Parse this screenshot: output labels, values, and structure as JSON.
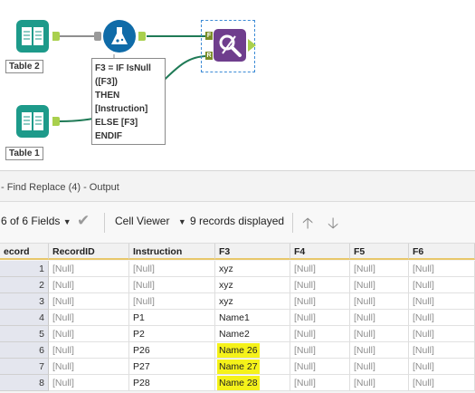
{
  "canvas": {
    "nodes": {
      "table2": {
        "label": "Table 2",
        "icon": "book-icon"
      },
      "table1": {
        "label": "Table 1",
        "icon": "book-icon"
      },
      "formula": {
        "icon": "flask-icon"
      },
      "find_replace": {
        "icon": "find-replace-icon",
        "anchor_f": "F",
        "anchor_r": "R"
      }
    },
    "formula_annotation": "F3 = IF IsNull\n([F3])\nTHEN\n[Instruction]\nELSE [F3]\nENDIF"
  },
  "results": {
    "title": "- Find Replace (4) - Output",
    "fields_selector": "6 of 6 Fields",
    "view_selector": "Cell Viewer",
    "records_status": "9 records displayed",
    "colors": {
      "highlight": "#f5f21a",
      "header_underline": "#e8c76a",
      "tool_teal": "#1d9a8a",
      "tool_purple": "#6f3e8d",
      "tool_blue": "#0f6ba8"
    },
    "columns": [
      "ecord",
      "RecordID",
      "Instruction",
      "F3",
      "F4",
      "F5",
      "F6"
    ],
    "rows": [
      {
        "n": "1",
        "cells": [
          "[Null]",
          "[Null]",
          "xyz",
          "[Null]",
          "[Null]",
          "[Null]"
        ]
      },
      {
        "n": "2",
        "cells": [
          "[Null]",
          "[Null]",
          "xyz",
          "[Null]",
          "[Null]",
          "[Null]"
        ]
      },
      {
        "n": "3",
        "cells": [
          "[Null]",
          "[Null]",
          "xyz",
          "[Null]",
          "[Null]",
          "[Null]"
        ]
      },
      {
        "n": "4",
        "cells": [
          "[Null]",
          "P1",
          "Name1",
          "[Null]",
          "[Null]",
          "[Null]"
        ]
      },
      {
        "n": "5",
        "cells": [
          "[Null]",
          "P2",
          "Name2",
          "[Null]",
          "[Null]",
          "[Null]"
        ]
      },
      {
        "n": "6",
        "cells": [
          "[Null]",
          "P26",
          "Name 26",
          "[Null]",
          "[Null]",
          "[Null]"
        ]
      },
      {
        "n": "7",
        "cells": [
          "[Null]",
          "P27",
          "Name 27",
          "[Null]",
          "[Null]",
          "[Null]"
        ]
      },
      {
        "n": "8",
        "cells": [
          "[Null]",
          "P28",
          "Name 28",
          "[Null]",
          "[Null]",
          "[Null]"
        ]
      }
    ],
    "highlighted_rows": [
      "6",
      "7",
      "8"
    ]
  }
}
